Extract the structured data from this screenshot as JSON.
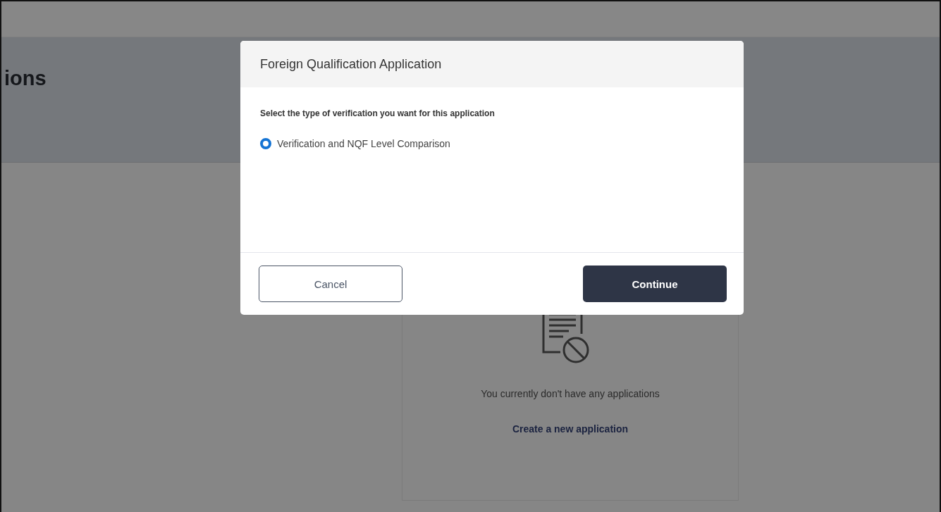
{
  "page": {
    "heading": "ions"
  },
  "empty_state": {
    "message": "You currently don't have any applications",
    "link": "Create a new application"
  },
  "dialog": {
    "title": "Foreign Qualification Application",
    "prompt": "Select the type of verification you want for this application",
    "options": [
      {
        "label": "Verification and NQF Level Comparison",
        "selected": true
      }
    ],
    "buttons": [
      {
        "label": "Cancel",
        "kind": "secondary"
      },
      {
        "label": "Continue",
        "kind": "primary"
      }
    ]
  }
}
